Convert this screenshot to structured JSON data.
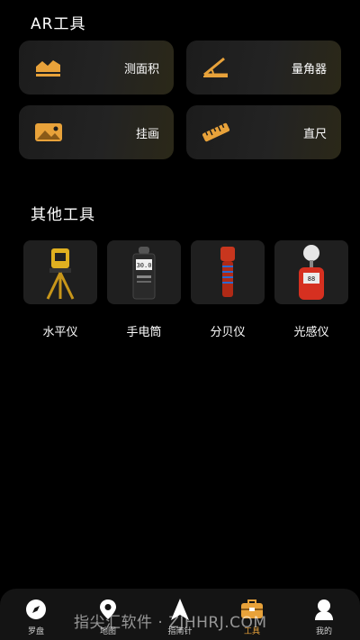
{
  "ar_section": {
    "title": "AR工具",
    "cards": [
      {
        "label": "测面积",
        "icon": "area-icon"
      },
      {
        "label": "量角器",
        "icon": "protractor-icon"
      },
      {
        "label": "挂画",
        "icon": "picture-icon"
      },
      {
        "label": "直尺",
        "icon": "ruler-icon"
      }
    ]
  },
  "other_section": {
    "title": "其他工具",
    "tools": [
      {
        "label": "水平仪",
        "icon": "theodolite-icon"
      },
      {
        "label": "手电筒",
        "icon": "sound-meter-icon"
      },
      {
        "label": "分贝仪",
        "icon": "flashlight-icon"
      },
      {
        "label": "光感仪",
        "icon": "lux-meter-icon"
      }
    ]
  },
  "tabbar": {
    "active": "工具",
    "tabs": [
      {
        "label": "罗盘",
        "icon": "compass-icon"
      },
      {
        "label": "地图",
        "icon": "map-pin-icon"
      },
      {
        "label": "指南针",
        "icon": "arrow-icon"
      },
      {
        "label": "工具",
        "icon": "toolbox-icon"
      },
      {
        "label": "我的",
        "icon": "user-icon"
      }
    ]
  },
  "watermark": "指尖汇软件 · ZJHHRJ.COM",
  "colors": {
    "accent": "#e8a23a",
    "background": "#000000",
    "card": "#1f1f1f"
  }
}
